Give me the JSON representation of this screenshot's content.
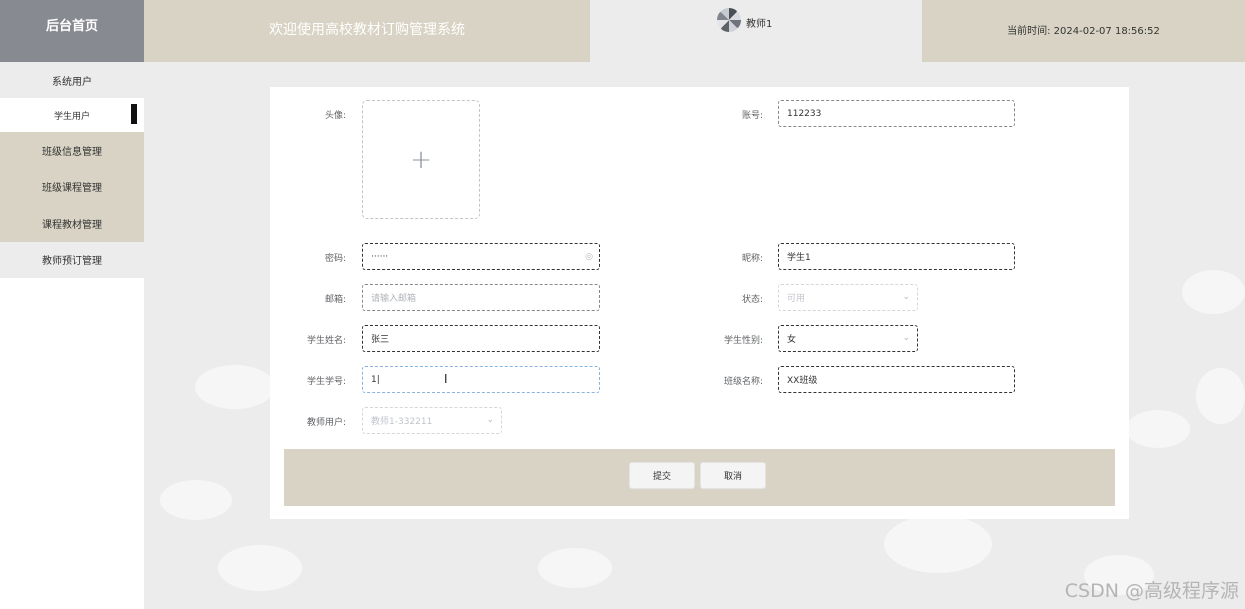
{
  "header": {
    "brand": "后台首页",
    "welcome": "欢迎使用高校教材订购管理系统",
    "username": "教师1",
    "time_label": "当前时间:  2024-02-07 18:56:52"
  },
  "sidebar": {
    "items": [
      {
        "label": "系统用户"
      },
      {
        "label": "学生用户"
      },
      {
        "label": "班级信息管理"
      },
      {
        "label": "班级课程管理"
      },
      {
        "label": "课程教材管理"
      },
      {
        "label": "教师预订管理"
      }
    ]
  },
  "form": {
    "avatar_label": "头像:",
    "account_label": "账号:",
    "account_value": "112233",
    "password_label": "密码:",
    "password_value": "······",
    "nickname_label": "昵称:",
    "nickname_value": "学生1",
    "email_label": "邮箱:",
    "email_placeholder": "请输入邮箱",
    "status_label": "状态:",
    "status_value": "可用",
    "student_name_label": "学生姓名:",
    "student_name_value": "张三",
    "student_gender_label": "学生性别:",
    "student_gender_value": "女",
    "student_no_label": "学生学号:",
    "student_no_value": "1|",
    "class_name_label": "班级名称:",
    "class_name_value": "XX班级",
    "teacher_label": "教师用户:",
    "teacher_value": "教师1-332211"
  },
  "actions": {
    "submit": "提交",
    "cancel": "取消"
  },
  "watermark": "CSDN @高级程序源",
  "icons": {
    "upload": "plus-icon",
    "password_toggle": "eye-icon",
    "select": "chevron-down-icon",
    "cursor": "text-cursor-icon"
  },
  "colors": {
    "header_gray": "#878a90",
    "header_beige": "#d8d3c4",
    "background": "#ececec"
  }
}
